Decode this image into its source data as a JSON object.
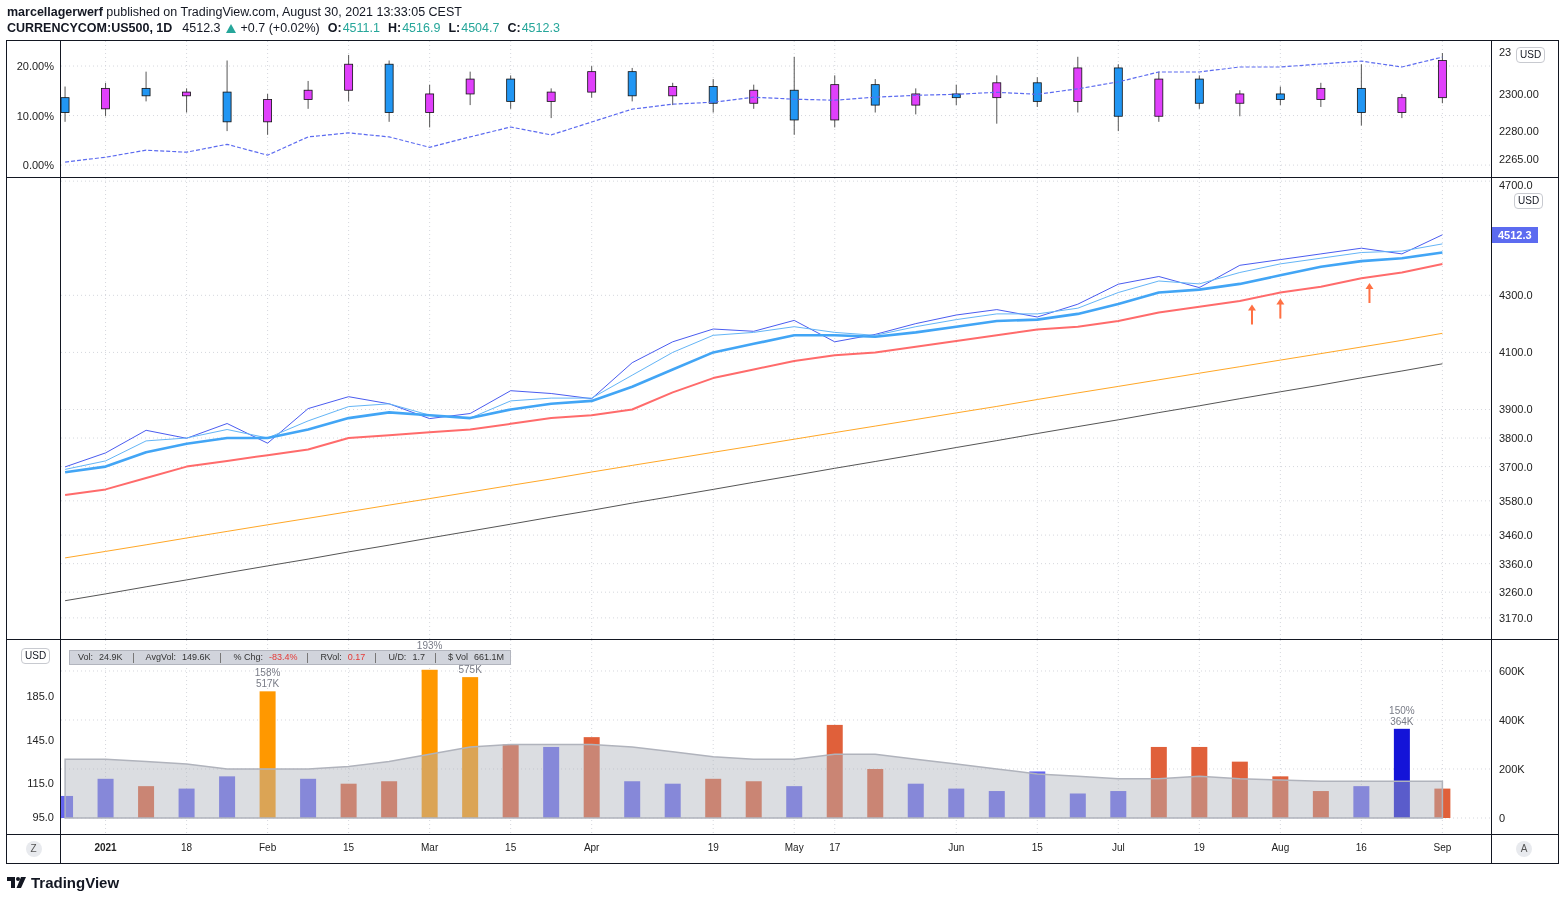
{
  "header": {
    "byline": "**marcellagerwerf** published on TradingView.com, August 30, 2021 13:33:05 CEST",
    "symbol": "CURRENCYCOM:US500, 1D",
    "price": "4512.3",
    "change_up": true,
    "change": "+0.7 (+0.02%)",
    "ohlc": [
      {
        "label": "O:",
        "value": "4511.1"
      },
      {
        "label": "H:",
        "value": "4516.9"
      },
      {
        "label": "L:",
        "value": "4504.7"
      },
      {
        "label": "C:",
        "value": "4512.3"
      }
    ]
  },
  "top_panel": {
    "currency_badge": "USD",
    "clipped_axis_label": "23",
    "chart_data": {
      "type": "candlestick",
      "grid": true,
      "ylim": [
        2255.3,
        2328.5
      ],
      "yticks": [
        {
          "value": 2300,
          "label": "2300.00"
        },
        {
          "value": 2280,
          "label": "2280.00"
        },
        {
          "value": 2265,
          "label": "2265.00"
        }
      ],
      "ohlc": [
        [
          2298,
          2304,
          2285,
          2290
        ],
        [
          2292,
          2306,
          2288,
          2303
        ],
        [
          2303,
          2312,
          2296,
          2299
        ],
        [
          2299,
          2303,
          2290,
          2301
        ],
        [
          2301,
          2318,
          2280,
          2285
        ],
        [
          2285,
          2300,
          2278,
          2297
        ],
        [
          2297,
          2307,
          2292,
          2302
        ],
        [
          2302,
          2321,
          2296,
          2316
        ],
        [
          2316,
          2318,
          2285,
          2290
        ],
        [
          2290,
          2305,
          2282,
          2300
        ],
        [
          2300,
          2312,
          2294,
          2308
        ],
        [
          2308,
          2310,
          2292,
          2296
        ],
        [
          2296,
          2303,
          2287,
          2301
        ],
        [
          2301,
          2315,
          2298,
          2312
        ],
        [
          2312,
          2314,
          2296,
          2299
        ],
        [
          2299,
          2306,
          2294,
          2304
        ],
        [
          2304,
          2308,
          2290,
          2295
        ],
        [
          2295,
          2305,
          2292,
          2302
        ],
        [
          2302,
          2320,
          2278,
          2286
        ],
        [
          2286,
          2310,
          2282,
          2305
        ],
        [
          2305,
          2308,
          2290,
          2294
        ],
        [
          2294,
          2303,
          2289,
          2300
        ],
        [
          2300,
          2305,
          2294,
          2298
        ],
        [
          2298,
          2310,
          2284,
          2306
        ],
        [
          2306,
          2309,
          2293,
          2296
        ],
        [
          2296,
          2320,
          2290,
          2314
        ],
        [
          2314,
          2316,
          2280,
          2288
        ],
        [
          2288,
          2312,
          2285,
          2308
        ],
        [
          2308,
          2310,
          2292,
          2295
        ],
        [
          2295,
          2302,
          2288,
          2300
        ],
        [
          2300,
          2304,
          2294,
          2297
        ],
        [
          2297,
          2306,
          2293,
          2303
        ],
        [
          2303,
          2316,
          2283,
          2290
        ],
        [
          2290,
          2300,
          2287,
          2298
        ],
        [
          2298,
          2322,
          2295,
          2318
        ]
      ],
      "y2lim": [
        -2.4,
        25.05
      ],
      "y2ticks": [
        {
          "value": 0,
          "label": "0.00%"
        },
        {
          "value": 10,
          "label": "10.00%"
        },
        {
          "value": 20,
          "label": "20.00%"
        }
      ],
      "series": [
        {
          "type": "line",
          "axis": "y2",
          "line_style": "dashed",
          "color": "#5c6bf0",
          "values": [
            0.6,
            1.6,
            3.0,
            2.6,
            4.2,
            2.0,
            5.7,
            6.5,
            5.7,
            3.6,
            5.7,
            7.7,
            6.1,
            8.7,
            11.3,
            12.3,
            12.7,
            13.7,
            13.3,
            13.1,
            13.7,
            14.1,
            14.3,
            14.7,
            14.3,
            15.4,
            16.8,
            18.8,
            18.8,
            19.8,
            19.8,
            20.4,
            21.0,
            19.8,
            21.8
          ]
        }
      ]
    }
  },
  "main_panel": {
    "currency_badge": "USD",
    "last_price": "4512.3",
    "chart_data": {
      "type": "line",
      "grid": true,
      "ylim": [
        3096,
        4711
      ],
      "yticks": [
        {
          "value": 4700,
          "label": "4700.0"
        },
        {
          "value": 4300,
          "label": "4300.0"
        },
        {
          "value": 4100,
          "label": "4100.0"
        },
        {
          "value": 3900,
          "label": "3900.0"
        },
        {
          "value": 3800,
          "label": "3800.0"
        },
        {
          "value": 3700,
          "label": "3700.0"
        },
        {
          "value": 3580,
          "label": "3580.0"
        },
        {
          "value": 3460,
          "label": "3460.0"
        },
        {
          "value": 3360,
          "label": "3360.0"
        },
        {
          "value": 3260,
          "label": "3260.0"
        },
        {
          "value": 3170,
          "label": "3170.0"
        }
      ],
      "series": [
        {
          "color": "#4a5cf0",
          "values": [
            3699,
            3748,
            3827,
            3799,
            3851,
            3782,
            3903,
            3945,
            3920,
            3868,
            3886,
            3966,
            3956,
            3938,
            4064,
            4137,
            4182,
            4174,
            4212,
            4137,
            4163,
            4201,
            4231,
            4250,
            4224,
            4269,
            4339,
            4366,
            4327,
            4405,
            4425,
            4445,
            4465,
            4445,
            4512
          ]
        },
        {
          "color": "#64b5f6",
          "values": [
            3690,
            3720,
            3790,
            3800,
            3830,
            3800,
            3860,
            3910,
            3920,
            3880,
            3870,
            3930,
            3940,
            3940,
            4020,
            4100,
            4160,
            4170,
            4190,
            4170,
            4160,
            4190,
            4215,
            4235,
            4235,
            4255,
            4310,
            4350,
            4340,
            4380,
            4410,
            4430,
            4450,
            4455,
            4480
          ]
        },
        {
          "color": "#42a5f5",
          "values": [
            3680,
            3700,
            3750,
            3780,
            3800,
            3800,
            3830,
            3870,
            3890,
            3880,
            3870,
            3900,
            3920,
            3930,
            3980,
            4040,
            4100,
            4130,
            4160,
            4160,
            4155,
            4170,
            4190,
            4210,
            4215,
            4235,
            4270,
            4310,
            4320,
            4340,
            4370,
            4400,
            4420,
            4430,
            4450
          ]
        },
        {
          "color": "#ff6b6b",
          "values": [
            3600,
            3620,
            3660,
            3700,
            3720,
            3740,
            3760,
            3800,
            3810,
            3820,
            3830,
            3850,
            3870,
            3880,
            3900,
            3960,
            4010,
            4040,
            4070,
            4090,
            4100,
            4120,
            4140,
            4160,
            4180,
            4190,
            4210,
            4240,
            4260,
            4280,
            4310,
            4330,
            4360,
            4380,
            4410
          ]
        },
        {
          "color": "#ffa726",
          "values": [
            3380,
            3403,
            3426,
            3450,
            3473,
            3496,
            3519,
            3542,
            3565,
            3588,
            3611,
            3634,
            3657,
            3681,
            3704,
            3727,
            3750,
            3773,
            3796,
            3819,
            3842,
            3865,
            3888,
            3911,
            3935,
            3958,
            3981,
            4004,
            4027,
            4050,
            4073,
            4096,
            4119,
            4142,
            4167
          ]
        },
        {
          "color": "#555555",
          "values": [
            3230,
            3254,
            3279,
            3303,
            3328,
            3352,
            3376,
            3401,
            3425,
            3450,
            3474,
            3498,
            3523,
            3547,
            3572,
            3596,
            3620,
            3645,
            3669,
            3694,
            3718,
            3742,
            3767,
            3791,
            3816,
            3840,
            3864,
            3889,
            3913,
            3938,
            3962,
            3986,
            4011,
            4035,
            4060
          ]
        }
      ]
    }
  },
  "volume_panel": {
    "currency_badge": "USD",
    "left_axis_labels": [
      "185.0",
      "145.0",
      "115.0",
      "95.0"
    ],
    "legend": [
      {
        "label": "Vol:",
        "value": "24.9K",
        "negative": false
      },
      {
        "label": "AvgVol:",
        "value": "149.6K",
        "negative": false
      },
      {
        "label": "% Chg:",
        "value": "-83.4%",
        "negative": true
      },
      {
        "label": "RVol:",
        "value": "0.17",
        "negative": true
      },
      {
        "label": "U/D:",
        "value": "1.7",
        "negative": false
      },
      {
        "label": "$ Vol",
        "value": "661.1M",
        "negative": false
      }
    ],
    "chart_data": {
      "type": "bar",
      "grid": true,
      "categories": [
        null,
        "2021",
        null,
        "18",
        null,
        "Feb",
        null,
        "15",
        null,
        "Mar",
        null,
        "15",
        null,
        "Apr",
        null,
        null,
        "19",
        null,
        "May",
        "17",
        null,
        null,
        "Jun",
        null,
        "15",
        null,
        "Jul",
        null,
        "19",
        null,
        "Aug",
        null,
        "16",
        null,
        "Sep"
      ],
      "ylim": [
        -65.3,
        726.5
      ],
      "yticks": [
        {
          "value": 0,
          "label": "0"
        },
        {
          "value": 200,
          "label": "200K"
        },
        {
          "value": 400,
          "label": "400K"
        },
        {
          "value": 600,
          "label": "600K"
        }
      ],
      "series": [
        {
          "type": "bar",
          "color": "#6464f0",
          "values": [
            90,
            160,
            null,
            120,
            170,
            null,
            160,
            null,
            null,
            null,
            null,
            null,
            290,
            null,
            150,
            140,
            null,
            null,
            130,
            null,
            null,
            140,
            120,
            110,
            190,
            100,
            110,
            null,
            null,
            null,
            null,
            null,
            130,
            null,
            null
          ]
        },
        {
          "type": "bar",
          "color": "#e0603a",
          "values": [
            null,
            null,
            130,
            null,
            null,
            null,
            null,
            140,
            150,
            null,
            null,
            300,
            null,
            330,
            null,
            null,
            160,
            150,
            null,
            380,
            200,
            null,
            null,
            null,
            null,
            null,
            null,
            290,
            290,
            230,
            170,
            110,
            null,
            null,
            120
          ]
        },
        {
          "type": "bar",
          "color": "#ff9800",
          "values": [
            null,
            null,
            null,
            null,
            null,
            517,
            null,
            null,
            null,
            605,
            575,
            null,
            null,
            null,
            null,
            null,
            null,
            null,
            null,
            null,
            null,
            null,
            null,
            null,
            null,
            null,
            null,
            null,
            null,
            null,
            null,
            null,
            null,
            null,
            null
          ]
        },
        {
          "type": "bar",
          "color": "#1414d8",
          "values": [
            null,
            null,
            null,
            null,
            null,
            null,
            null,
            null,
            null,
            null,
            null,
            null,
            null,
            null,
            null,
            null,
            null,
            null,
            null,
            null,
            null,
            null,
            null,
            null,
            null,
            null,
            null,
            null,
            null,
            null,
            null,
            null,
            null,
            364,
            null
          ]
        },
        {
          "type": "area",
          "color": "#b0b3bc",
          "values": [
            240,
            240,
            230,
            220,
            200,
            200,
            200,
            210,
            230,
            260,
            290,
            300,
            300,
            300,
            290,
            270,
            250,
            240,
            240,
            260,
            260,
            240,
            220,
            200,
            180,
            170,
            160,
            160,
            170,
            160,
            155,
            150,
            150,
            150,
            150
          ]
        }
      ],
      "annotations": [
        {
          "text": "158%\n517K"
        },
        {
          "text": "193%"
        },
        {
          "text": "575K"
        },
        {
          "text": "150%\n364K"
        }
      ]
    }
  },
  "time_axis": {
    "left_button": "Z",
    "right_button": "A"
  },
  "footer": {
    "brand": "TradingView"
  }
}
